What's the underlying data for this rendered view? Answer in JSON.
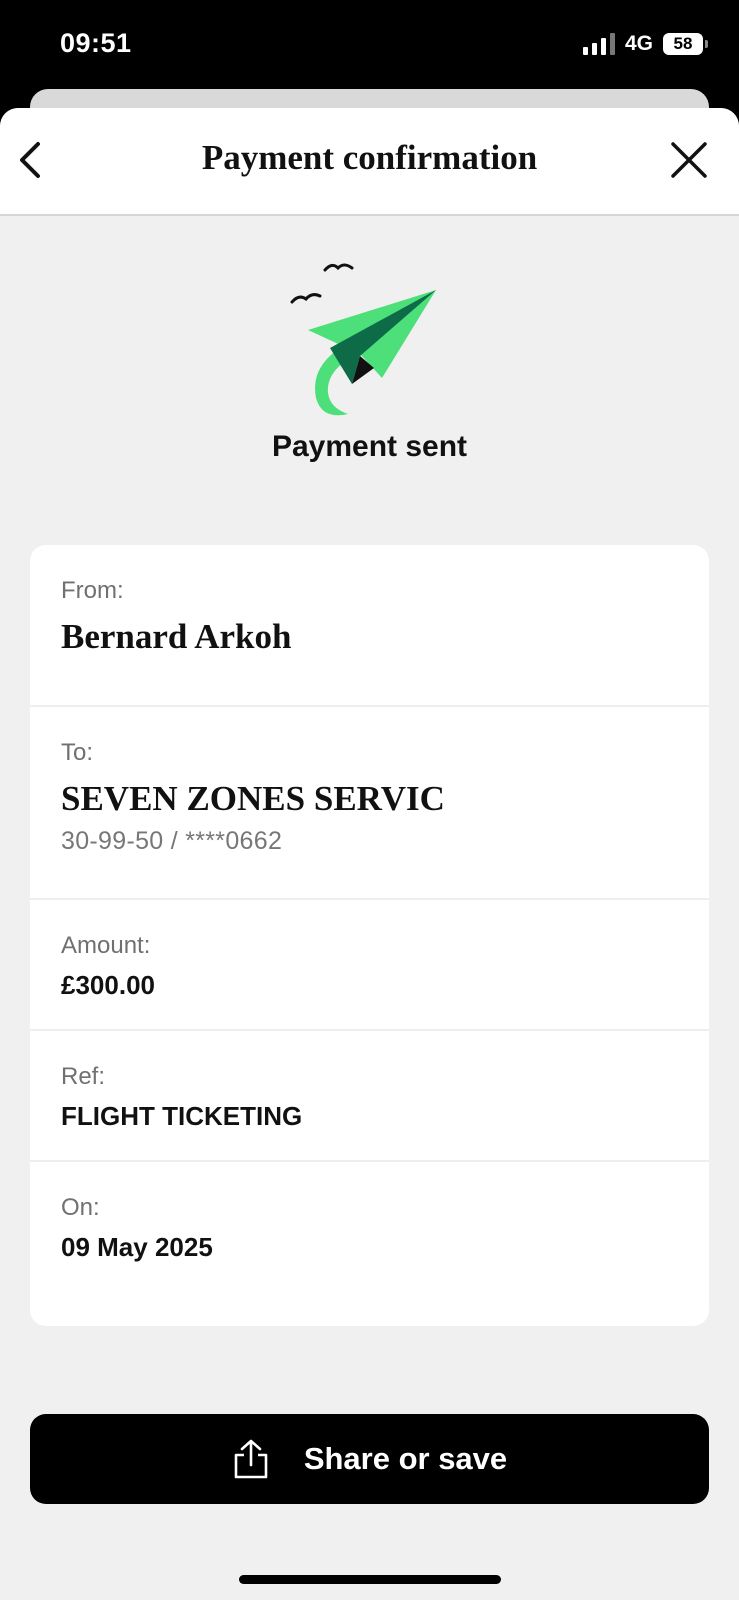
{
  "status_bar": {
    "time": "09:51",
    "network": "4G",
    "battery": "58"
  },
  "header": {
    "title": "Payment confirmation"
  },
  "hero": {
    "title": "Payment sent"
  },
  "details": {
    "from_label": "From:",
    "from_value": "Bernard Arkoh",
    "to_label": "To:",
    "to_value": "SEVEN ZONES SERVIC",
    "to_account": "30-99-50 / ****0662",
    "amount_label": "Amount:",
    "amount_value": "£300.00",
    "ref_label": "Ref:",
    "ref_value": "FLIGHT TICKETING",
    "on_label": "On:",
    "on_value": "09 May 2025"
  },
  "actions": {
    "share_label": "Share or save"
  },
  "colors": {
    "accent_green": "#4de07a",
    "dark_green": "#0d6b48",
    "background": "#f0f0f0"
  },
  "icons": [
    "back-chevron-icon",
    "close-icon",
    "paper-plane-icon",
    "share-icon"
  ]
}
